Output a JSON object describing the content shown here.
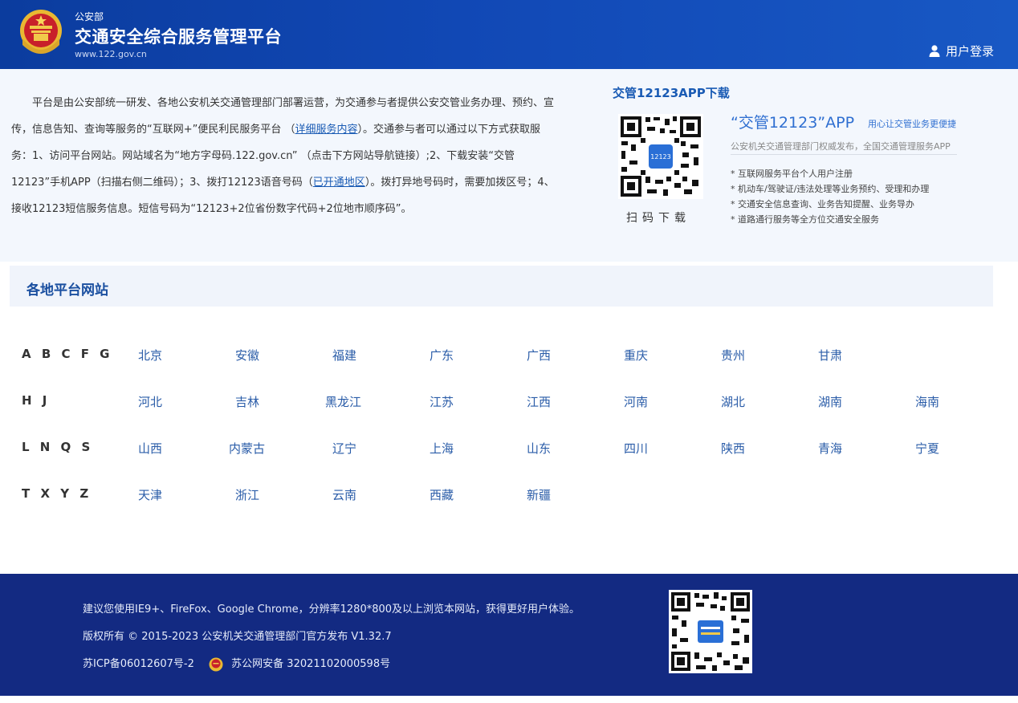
{
  "header": {
    "org": "公安部",
    "title": "交通安全综合服务管理平台",
    "url": "www.122.gov.cn",
    "login_label": "用户登录"
  },
  "intro": {
    "p1": "平台是由公安部统一研发、各地公安机关交通管理部门部署运营，为交通参与者提供公安交管业务办理、预约、宣传，信息告知、查询等服务的“互联网+”便民利民服务平台 （",
    "link1": "详细服务内容",
    "p2": "）。交通参与者可以通过以下方式获取服务：1、访问平台网站。网站域名为“地方字母码.122.gov.cn” （点击下方网站导航链接）;2、下载安装“交管12123”手机APP（扫描右侧二维码）；3、拨打12123语音号码（",
    "link2": "已开通地区",
    "p3": "）。拨打异地号码时，需要加拨区号；4、接收12123短信服务信息。短信号码为“12123+2位省份数字代码+2位地市顺序码”。"
  },
  "app": {
    "download_title": "交管12123APP下载",
    "scan_caption": "扫码下载",
    "name": "“交管12123”APP",
    "slogan": "用心让交管业务更便捷",
    "subtitle": "公安机关交通管理部门权威发布，全国交通管理服务APP",
    "features": [
      "互联网服务平台个人用户注册",
      "机动车/驾驶证/违法处理等业务预约、受理和办理",
      "交通安全信息查询、业务告知提醒、业务导办",
      "道路通行服务等全方位交通安全服务"
    ]
  },
  "regions": {
    "title": "各地平台网站",
    "rows": [
      {
        "letters": "ABCFG",
        "provinces": [
          "北京",
          "安徽",
          "福建",
          "广东",
          "广西",
          "重庆",
          "贵州",
          "甘肃"
        ]
      },
      {
        "letters": "HJ",
        "provinces": [
          "河北",
          "吉林",
          "黑龙江",
          "江苏",
          "江西",
          "河南",
          "湖北",
          "湖南",
          "海南"
        ]
      },
      {
        "letters": "LNQS",
        "provinces": [
          "山西",
          "内蒙古",
          "辽宁",
          "上海",
          "山东",
          "四川",
          "陕西",
          "青海",
          "宁夏"
        ]
      },
      {
        "letters": "TXYZ",
        "provinces": [
          "天津",
          "浙江",
          "云南",
          "西藏",
          "新疆"
        ]
      }
    ]
  },
  "footer": {
    "browser_note": "建议您使用IE9+、FireFox、Google Chrome，分辨率1280*800及以上浏览本网站，获得更好用户体验。",
    "copyright": "版权所有 © 2015-2023 公安机关交通管理部门官方发布 V1.32.7",
    "icp": "苏ICP备06012607号-2",
    "police_record": "苏公网安备 32021102000598号"
  },
  "colors": {
    "header_blue": "#1148b5",
    "footer_navy": "#132a82",
    "link_blue": "#2a5ca8",
    "intro_bg": "#f3f7fd"
  }
}
